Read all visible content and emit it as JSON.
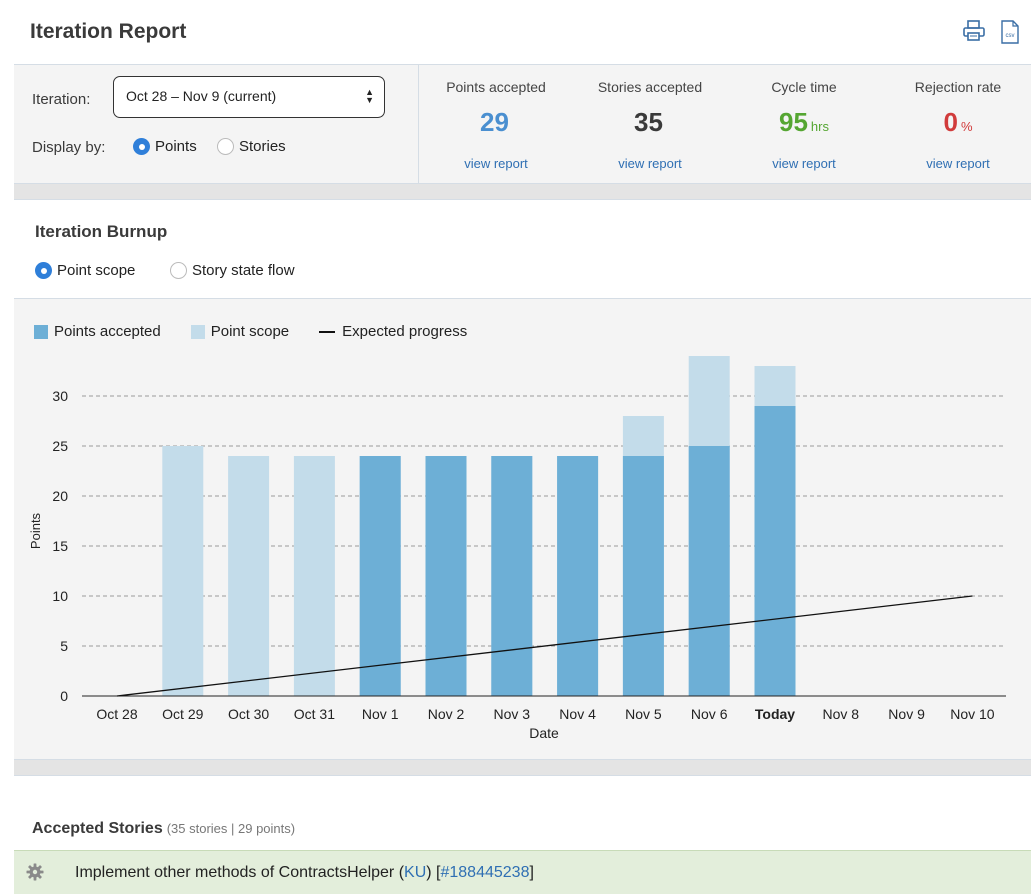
{
  "header": {
    "title": "Iteration Report",
    "print_icon": "printer-icon",
    "csv_icon": "csv-file-icon",
    "csv_icon_text": "csv"
  },
  "controls": {
    "iteration_label": "Iteration:",
    "iteration_value": "Oct 28 – Nov 9 (current)",
    "display_label": "Display by:",
    "display_options": [
      {
        "label": "Points",
        "selected": true
      },
      {
        "label": "Stories",
        "selected": false
      }
    ]
  },
  "metrics": [
    {
      "label": "Points accepted",
      "value": "29",
      "unit": "",
      "color": "#4a8fd0",
      "link": "view report"
    },
    {
      "label": "Stories accepted",
      "value": "35",
      "unit": "",
      "color": "#3a3a3a",
      "link": "view report"
    },
    {
      "label": "Cycle time",
      "value": "95",
      "unit": "hrs",
      "color": "#55a632",
      "link": "view report"
    },
    {
      "label": "Rejection rate",
      "value": "0",
      "unit": "%",
      "color": "#d13b3b",
      "link": "view report"
    }
  ],
  "burnup": {
    "title": "Iteration Burnup",
    "modes": [
      {
        "label": "Point scope",
        "selected": true
      },
      {
        "label": "Story state flow",
        "selected": false
      }
    ]
  },
  "chart_data": {
    "type": "bar",
    "xlabel": "Date",
    "ylabel": "Points",
    "ylim": [
      0,
      35
    ],
    "yticks": [
      0,
      5,
      10,
      15,
      20,
      25,
      30
    ],
    "grid": true,
    "legend_position": "top-left",
    "categories": [
      "Oct 28",
      "Oct 29",
      "Oct 30",
      "Oct 31",
      "Nov 1",
      "Nov 2",
      "Nov 3",
      "Nov 4",
      "Nov 5",
      "Nov 6",
      "Today",
      "Nov 8",
      "Nov 9",
      "Nov 10"
    ],
    "bold_category": "Today",
    "series": [
      {
        "name": "Points accepted",
        "color": "#6dafd6",
        "values": [
          null,
          0,
          0,
          0,
          24,
          24,
          24,
          24,
          24,
          25,
          29,
          null,
          null,
          null
        ]
      },
      {
        "name": "Point scope",
        "color": "#c3dcea",
        "values": [
          null,
          25,
          24,
          24,
          24,
          24,
          24,
          24,
          28,
          34,
          33,
          null,
          null,
          null
        ]
      }
    ],
    "expected_progress": {
      "name": "Expected progress",
      "color": "#111111",
      "start": [
        "Oct 28",
        0
      ],
      "end": [
        "Nov 10",
        10
      ]
    }
  },
  "accepted_stories": {
    "title": "Accepted Stories",
    "summary": "(35 stories | 29 points)",
    "items": [
      {
        "icon": "gear-icon",
        "text": "Implement other methods of ContractsHelper (",
        "owner": "KU",
        "mid": ") [",
        "id": "#188445238",
        "end": "]"
      }
    ]
  }
}
